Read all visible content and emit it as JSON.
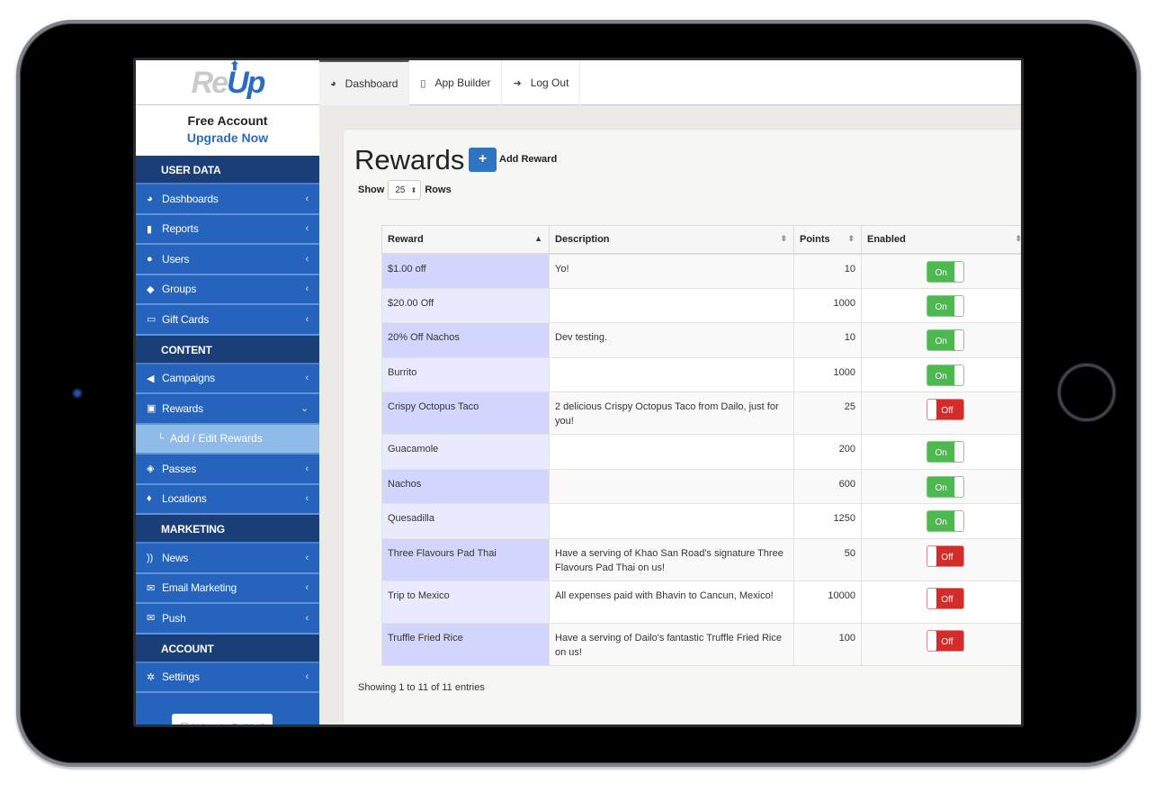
{
  "app": {
    "logo_part1": "Re",
    "logo_part2": "Up",
    "accent_color": "#2563bd"
  },
  "topnav": [
    {
      "label": "Dashboard",
      "icon": "dashboard-icon",
      "glyph": "◕",
      "active": true
    },
    {
      "label": "App Builder",
      "icon": "mobile-icon",
      "glyph": "▯",
      "active": false
    },
    {
      "label": "Log Out",
      "icon": "logout-icon",
      "glyph": "➜",
      "active": false
    }
  ],
  "account": {
    "plan": "Free Account",
    "upgrade": "Upgrade Now"
  },
  "sidebar": {
    "sections": {
      "user_data": "USER DATA",
      "content": "CONTENT",
      "marketing": "MARKETING",
      "account": "ACCOUNT"
    },
    "items": [
      {
        "label": "Dashboards",
        "glyph": "◕"
      },
      {
        "label": "Reports",
        "glyph": "▮"
      },
      {
        "label": "Users",
        "glyph": "●"
      },
      {
        "label": "Groups",
        "glyph": "◆"
      },
      {
        "label": "Gift Cards",
        "glyph": "▭"
      },
      {
        "label": "Campaigns",
        "glyph": "◀"
      },
      {
        "label": "Rewards",
        "glyph": "▣"
      },
      {
        "label": "Passes",
        "glyph": "◈"
      },
      {
        "label": "Locations",
        "glyph": "♦"
      },
      {
        "label": "News",
        "glyph": "))"
      },
      {
        "label": "Email Marketing",
        "glyph": "✉"
      },
      {
        "label": "Push",
        "glyph": "✉"
      },
      {
        "label": "Settings",
        "glyph": "✲"
      }
    ],
    "chevron_collapsed": "‹",
    "chevron_expanded": "⌄",
    "subitem": {
      "label": "Add / Edit Rewards",
      "prefix": "└"
    },
    "what_button": "⦿ What is ReUp?"
  },
  "main": {
    "title": "Rewards",
    "add_button_glyph": "+",
    "add_button_label": "Add Reward",
    "show_label": "Show",
    "rows_value": "25",
    "rows_label": "Rows",
    "table": {
      "columns": [
        "Reward",
        "Description",
        "Points",
        "Enabled"
      ],
      "rows": [
        {
          "reward": "$1.00 off",
          "description": "Yo!",
          "points": "10",
          "enabled": "On"
        },
        {
          "reward": "$20.00 Off",
          "description": "",
          "points": "1000",
          "enabled": "On"
        },
        {
          "reward": "20% Off Nachos",
          "description": "Dev testing.",
          "points": "10",
          "enabled": "On"
        },
        {
          "reward": "Burrito",
          "description": "",
          "points": "1000",
          "enabled": "On"
        },
        {
          "reward": "Crispy Octopus Taco",
          "description": "2 delicious Crispy Octopus Taco from Dailo, just for you!",
          "points": "25",
          "enabled": "Off"
        },
        {
          "reward": "Guacamole",
          "description": "",
          "points": "200",
          "enabled": "On"
        },
        {
          "reward": "Nachos",
          "description": "",
          "points": "600",
          "enabled": "On"
        },
        {
          "reward": "Quesadilla",
          "description": "",
          "points": "1250",
          "enabled": "On"
        },
        {
          "reward": "Three Flavours Pad Thai",
          "description": "Have a serving of Khao San Road's signature Three Flavours Pad Thai on us!",
          "points": "50",
          "enabled": "Off"
        },
        {
          "reward": "Trip to Mexico",
          "description": "All expenses paid with Bhavin to Cancun, Mexico!",
          "points": "10000",
          "enabled": "Off"
        },
        {
          "reward": "Truffle Fried Rice",
          "description": "Have a serving of Dailo's fantastic Truffle Fried Rice on us!",
          "points": "100",
          "enabled": "Off"
        }
      ]
    },
    "footer": "Showing 1 to 11 of 11 entries"
  }
}
